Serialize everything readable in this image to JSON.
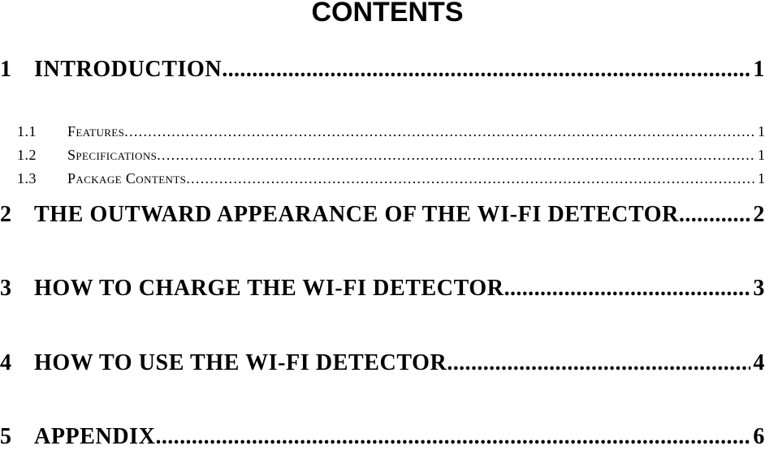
{
  "heading": "CONTENTS",
  "toc": [
    {
      "number": "1",
      "label": "INTRODUCTION",
      "page": "1",
      "level": 1
    },
    {
      "number": "1.1",
      "label": "Features",
      "page": "1",
      "level": 2
    },
    {
      "number": "1.2",
      "label": "Specifications",
      "page": "1",
      "level": 2
    },
    {
      "number": "1.3",
      "label": "Package Contents",
      "page": "1",
      "level": 2
    },
    {
      "number": "2",
      "label": "THE OUTWARD APPEARANCE OF THE WI-FI DETECTOR",
      "page": "2",
      "level": 1
    },
    {
      "number": "3",
      "label": "HOW TO CHARGE THE WI-FI DETECTOR",
      "page": "3",
      "level": 1
    },
    {
      "number": "4",
      "label": "HOW TO USE THE WI-FI DETECTOR",
      "page": "4",
      "level": 1
    },
    {
      "number": "5",
      "label": "APPENDIX",
      "page": "6",
      "level": 1
    }
  ]
}
